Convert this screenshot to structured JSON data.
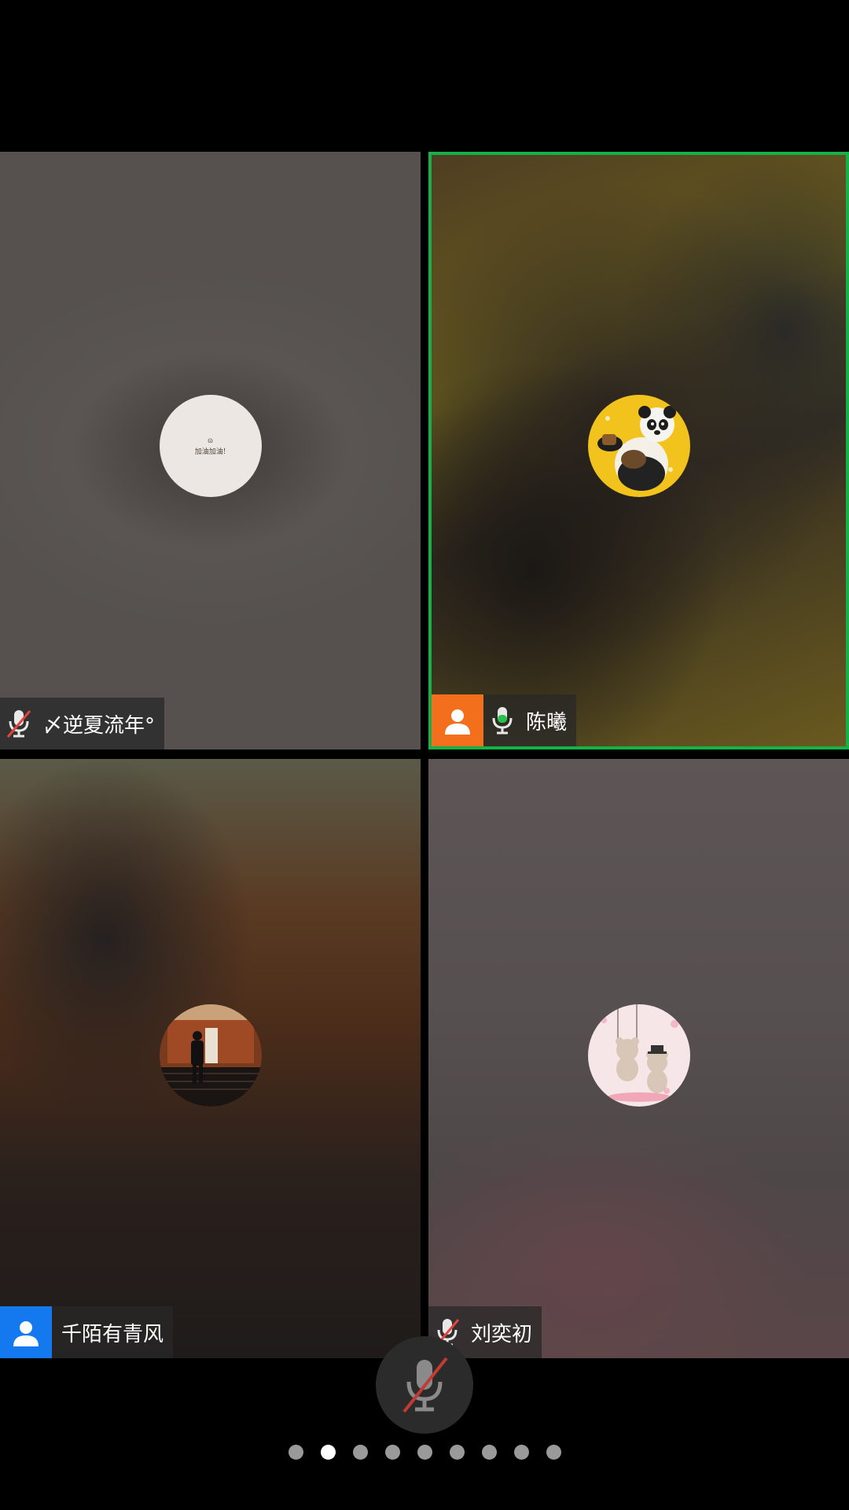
{
  "colors": {
    "active_border": "#16b148",
    "orange_badge": "#f36f1c",
    "blue_badge": "#1479ee",
    "muted_slash": "#e0463c",
    "active_mic": "#27c24c"
  },
  "participants": [
    {
      "name": "〆逆夏流年°",
      "mic": "muted",
      "badge": null,
      "avatar_text": "加油加油!",
      "active_speaker": false
    },
    {
      "name": "陈曦",
      "mic": "active",
      "badge": "person-icon-orange",
      "active_speaker": true
    },
    {
      "name": "千陌有青风",
      "mic": null,
      "badge": "person-icon-blue",
      "active_speaker": false
    },
    {
      "name": "刘奕初",
      "mic": "muted",
      "badge": null,
      "active_speaker": false
    }
  ],
  "controls": {
    "mute_button": {
      "icon": "mic-muted-icon",
      "state": "muted"
    }
  },
  "pagination": {
    "total": 9,
    "current": 2
  }
}
